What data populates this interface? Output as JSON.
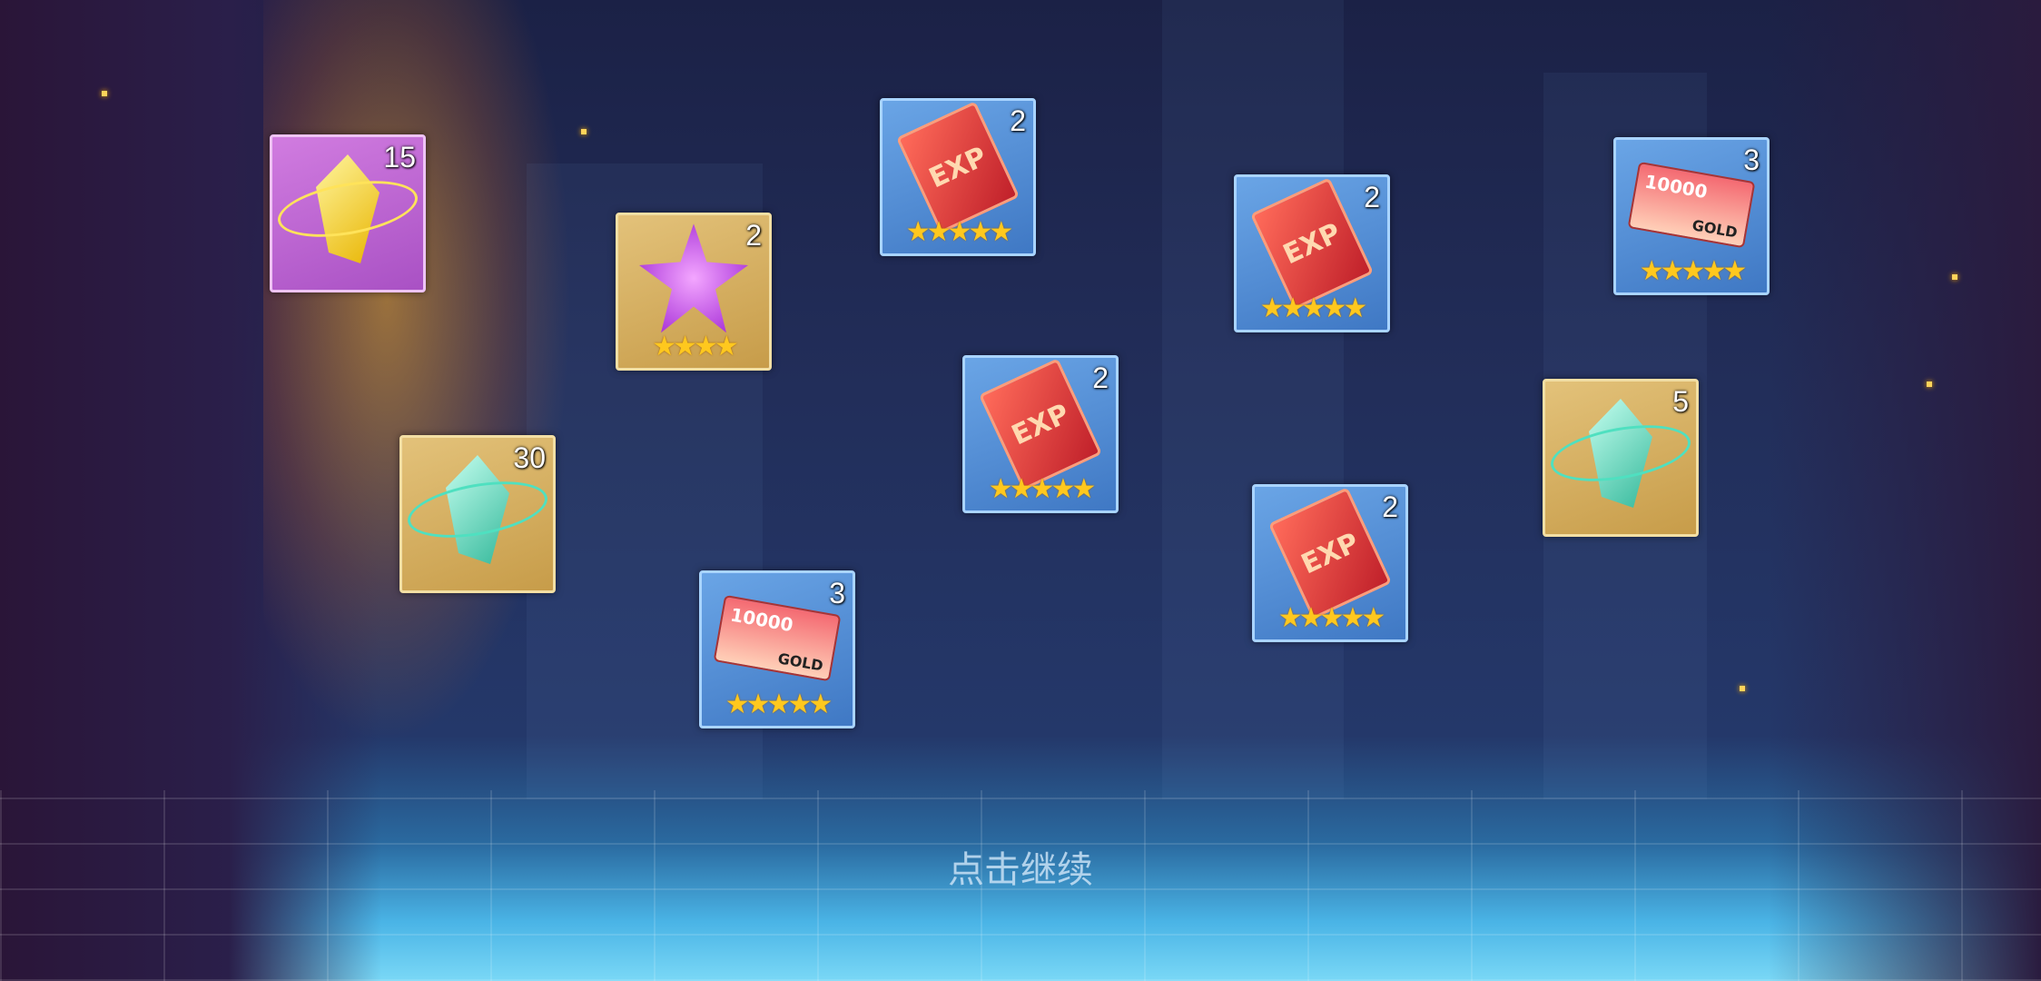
{
  "rewards": [
    {
      "item": "yellow-crystal",
      "rarity": "purple",
      "count": "15",
      "stars": 0
    },
    {
      "item": "purple-star-gem",
      "rarity": "gold",
      "count": "2",
      "stars": 4
    },
    {
      "item": "exp-book",
      "rarity": "blue",
      "count": "2",
      "stars": 5
    },
    {
      "item": "exp-book",
      "rarity": "blue",
      "count": "2",
      "stars": 5
    },
    {
      "item": "gold-ticket",
      "rarity": "blue",
      "count": "3",
      "stars": 5
    },
    {
      "item": "teal-crystal",
      "rarity": "gold",
      "count": "30",
      "stars": 0
    },
    {
      "item": "exp-book",
      "rarity": "blue",
      "count": "2",
      "stars": 5
    },
    {
      "item": "teal-crystal",
      "rarity": "gold",
      "count": "5",
      "stars": 0
    },
    {
      "item": "exp-book",
      "rarity": "blue",
      "count": "2",
      "stars": 5
    },
    {
      "item": "gold-ticket",
      "rarity": "blue",
      "count": "3",
      "stars": 5
    }
  ],
  "labels": {
    "exp": "EXP",
    "ticket_amount": "10000",
    "ticket_currency": "GOLD"
  },
  "continue_text": "点击继续"
}
